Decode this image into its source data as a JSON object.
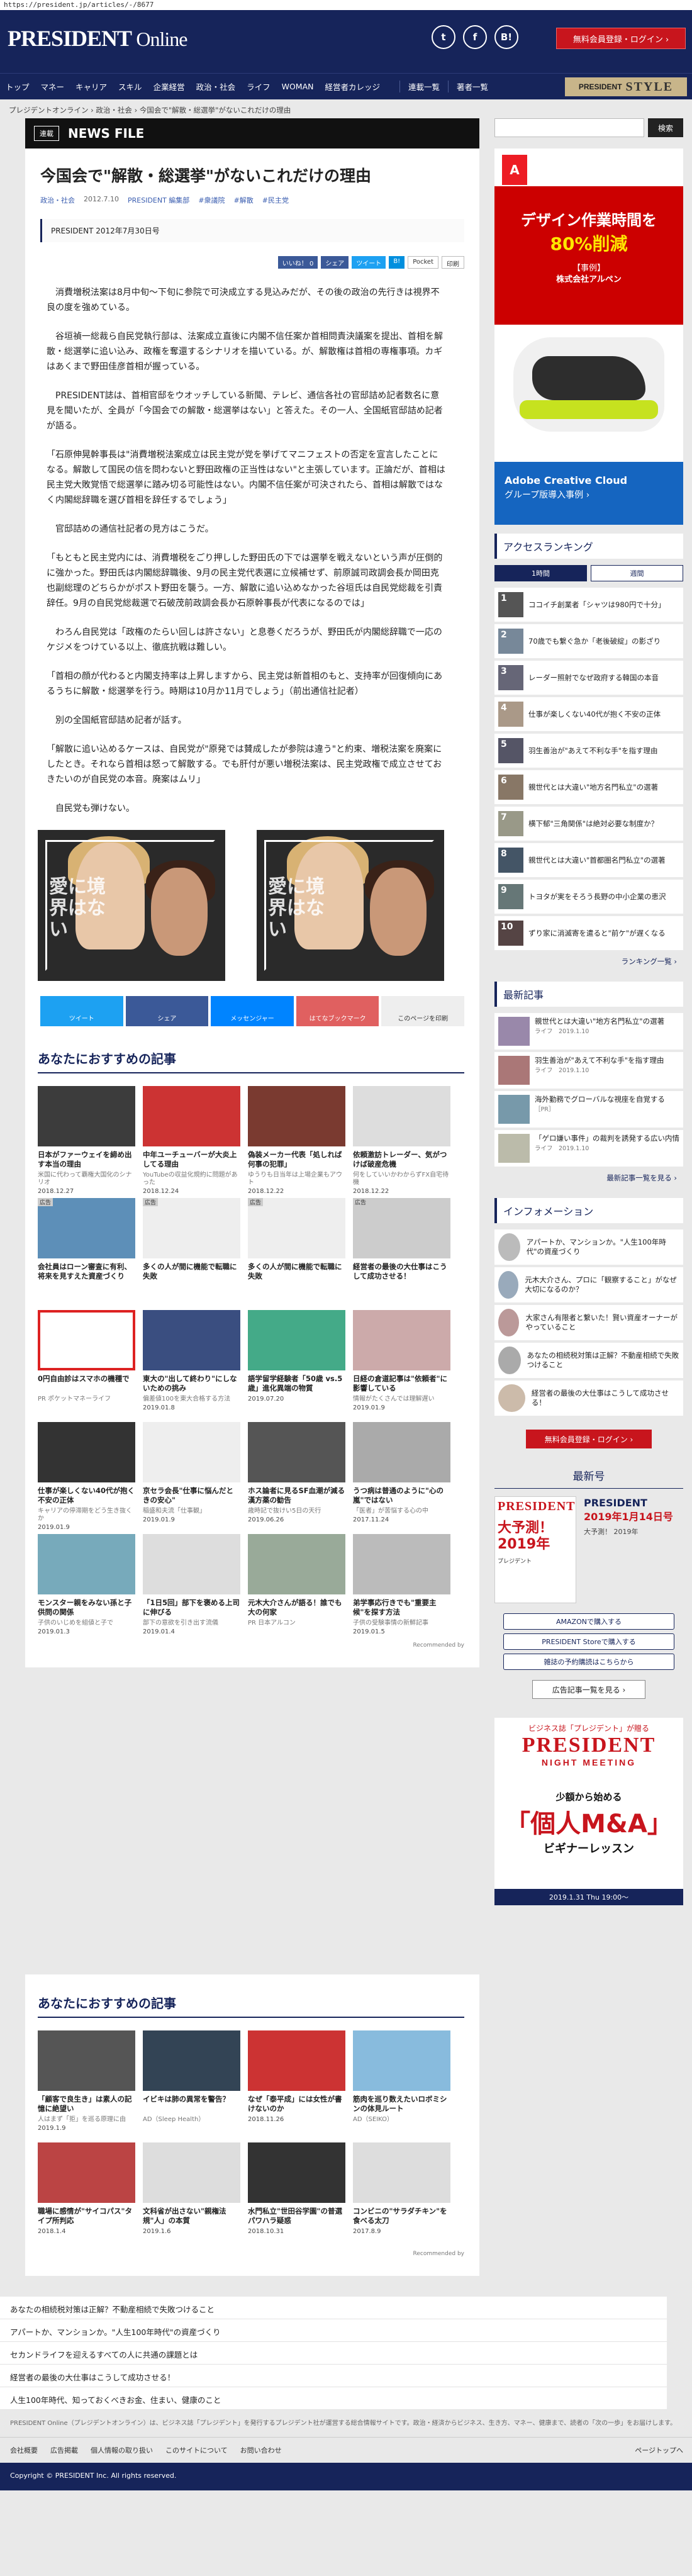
{
  "url": "https://president.jp/articles/-/8677",
  "header": {
    "logo_main": "PRESIDENT",
    "logo_sub": "Online",
    "icons": [
      "twitter-icon",
      "facebook-icon",
      "hatena-icon"
    ],
    "icon_glyphs": [
      "t",
      "f",
      "B!"
    ],
    "login_button": "無料会員登録・ログイン ›"
  },
  "nav": {
    "items": [
      "トップ",
      "マネー",
      "キャリア",
      "スキル",
      "企業経営",
      "政治・社会",
      "ライフ",
      "WOMAN",
      "経営者カレッジ"
    ],
    "extra": [
      "連載一覧",
      "著者一覧"
    ],
    "style_prefix": "PRESIDENT",
    "style_word": "STYLE"
  },
  "breadcrumb": "プレジデントオンライン  ›  政治・社会  ›  今国会で\"解散・総選挙\"がないこれだけの理由",
  "article": {
    "tag": "連載",
    "series": "NEWS FILE",
    "title": "今国会で\"解散・総選挙\"がないこれだけの理由",
    "meta": [
      "政治・社会",
      "2012.7.10",
      "PRESIDENT 編集部",
      "#衆議院",
      "#解散",
      "#民主党"
    ],
    "subtitle": "PRESIDENT 2012年7月30日号",
    "share_top": [
      "いいね！ 0",
      "シェア",
      "ツイート",
      "B!",
      "Pocket",
      "印刷"
    ],
    "paragraphs": [
      "　消費増税法案は8月中旬〜下旬に参院で可決成立する見込みだが、その後の政治の先行きは視界不良の度を強めている。",
      "　谷垣禎一総裁ら自民党執行部は、法案成立直後に内閣不信任案か首相問責決議案を提出、首相を解散・総選挙に追い込み、政権を奪還するシナリオを描いている。が、解散権は首相の専権事項。カギはあくまで野田佳彦首相が握っている。",
      "　PRESIDENT誌は、首相官邸をウオッチしている新聞、テレビ、通信各社の官邸詰め記者数名に意見を聞いたが、全員が「今国会での解散・総選挙はない」と答えた。その一人、全国紙官邸詰め記者が語る。",
      "「石原伸晃幹事長は\"消費増税法案成立は民主党が党を挙げてマニフェストの否定を宣言したことになる。解散して国民の信を問わないと野田政権の正当性はない\"と主張しています。正論だが、首相は民主党大敗覚悟で総選挙に踏み切る可能性はない。内閣不信任案が可決されたら、首相は解散ではなく内閣総辞職を選び首相を辞任するでしょう」",
      "　官邸詰めの通信社記者の見方はこうだ。",
      "「もともと民主党内には、消費増税をごり押しした野田氏の下では選挙を戦えないという声が圧倒的に強かった。野田氏は内閣総辞職後、9月の民主党代表選に立候補せず、前原誠司政調会長か岡田克也副総理のどちらかがポスト野田を襲う。一方、解散に追い込めなかった谷垣氏は自民党総裁を引責辞任。9月の自民党総裁選で石破茂前政調会長か石原幹事長が代表になるのでは」",
      "　わろん自民党は「政権のたらい回しは許さない」と息巻くだろうが、野田氏が内閣総辞職で一応のケジメをつけている以上、徹底抗戦は難しい。",
      "「首相の顔が代わると内閣支持率は上昇しますから、民主党は新首相のもと、支持率が回復傾向にあるうちに解散・総選挙を行う。時期は10月か11月でしょう」（前出通信社記者）",
      "　別の全国紙官邸詰め記者が話す。",
      "「解散に追い込めるケースは、自民党が\"原発では賛成したが参院は違う\"と約束、増税法案を廃案にしたとき。それなら首相は怒って解散する。でも肝付が悪い増税法案は、民主党政権で成立させておきたいのが自民党の本音。廃案はムリ」",
      "　自民党も弾けない。"
    ],
    "photo_caption": "愛に境界はない",
    "share_bottom": [
      "ツイート",
      "シェア",
      "メッセンジャー",
      "はてなブックマーク",
      "このページを印刷"
    ]
  },
  "recommend1": {
    "heading": "あなたにおすすめの記事",
    "cards": [
      {
        "title": "日本がファーウェイを締め出す本当の理由",
        "desc": "米国に代わって覇権大国化のシナリオ",
        "date": "2018.12.27",
        "color": "#3c3c3c"
      },
      {
        "title": "中年ユーチューバーが大炎上してる理由",
        "desc": "YouTubeの収益化規約に問題があった",
        "date": "2018.12.24",
        "color": "#c33"
      },
      {
        "title": "偽装メーカー代表「処しれば何事の犯罪」",
        "desc": "ゆうりも日当年は上場企業もアウト",
        "date": "2018.12.22",
        "color": "#7a3a30"
      },
      {
        "title": "依頼激訪トレーダー、気がつけば破産危機",
        "desc": "何をしていいかわからずFX自宅待機",
        "date": "2018.12.22",
        "color": "#ddd"
      },
      {
        "title": "会社員はローン審査に有利、将来を見すえた資産づくり",
        "desc": "",
        "date": "",
        "color": "#5d8fb8",
        "ad": true
      },
      {
        "title": "多くの人が間に機能で転職に失敗",
        "desc": "",
        "date": "",
        "color": "#eee",
        "ad": true
      },
      {
        "title": "多くの人が間に機能で転職に失敗",
        "desc": "",
        "date": "",
        "color": "#eee",
        "ad": true
      },
      {
        "title": "経営者の最後の大仕事はこうして成功させる！",
        "desc": "",
        "date": "",
        "color": "#ccc",
        "ad": true
      },
      {
        "title": "0円自由診はスマホの機種で",
        "desc": "PR ポケットマネーライフ",
        "date": "",
        "color": "#fff",
        "redborder": true
      },
      {
        "title": "東大の\"出して終わり\"にしないための挑み",
        "desc": "偏差値100を東大合格する方法",
        "date": "2019.01.8",
        "color": "#3a4e80"
      },
      {
        "title": "語学留学経験者「50歳 vs.5歳」進化異端の物質",
        "desc": "",
        "date": "2019.07.20",
        "color": "#4a8"
      },
      {
        "title": "日経の倉道記事は\"依頼者\"に影響している",
        "desc": "情報がたくさんでは理解遅い",
        "date": "2019.01.9",
        "color": "#caa"
      },
      {
        "title": "仕事が楽しくない40代が抱く不安の正体",
        "desc": "キャリアの停滞期をどう生き抜くか",
        "date": "2019.01.9",
        "color": "#333"
      },
      {
        "title": "京セラ会長\"仕事に悩んだときの安心\"",
        "desc": "稲盛和夫流「仕事観」",
        "date": "2019.01.9",
        "color": "#eee"
      },
      {
        "title": "ホス論者に見るSF血潮が減る漢方薬の勧告",
        "desc": "歳時記で抜けい5日の天行",
        "date": "2019.06.26",
        "color": "#555"
      },
      {
        "title": "うつ病は普通のように\"心の嵐\"ではない",
        "desc": "「医者」が苦悩する心の中",
        "date": "2017.11.24",
        "color": "#aaa"
      },
      {
        "title": "モンスター親をみない孫と子供問の関係",
        "desc": "子供のいじめを組値と子で",
        "date": "2019.01.3",
        "color": "#7ab"
      },
      {
        "title": "「1日5回」部下を褒める上司に伸びる",
        "desc": "部下の意欲を引き出す流儀",
        "date": "2019.01.4",
        "color": "#ddd"
      },
      {
        "title": "元木大介さんが語る！誰でも大の何家",
        "desc": "PR 日本アルコン",
        "date": "",
        "color": "#9a9"
      },
      {
        "title": "弟学事応行きでも\"重要主候\"を探す方法",
        "desc": "子供の受験事情の新鮮記事",
        "date": "2019.01.5",
        "color": "#bbb"
      }
    ],
    "recommended_by": "Recommended by"
  },
  "recommend2": {
    "heading": "あなたにおすすめの記事",
    "cards": [
      {
        "title": "「顧客で良生き」は素人の記憶に絶望い",
        "desc": "人はまず「拒」を巡る原理に由",
        "date": "2019.1.9",
        "color": "#555"
      },
      {
        "title": "イビキは肺の異常を警告？",
        "desc": "AD（Sleep Health）",
        "date": "",
        "color": "#345"
      },
      {
        "title": "なぜ「泰平成」には女性が書けないのか",
        "desc": "",
        "date": "2018.11.26",
        "color": "#c33"
      },
      {
        "title": "筋肉を巡り数えたいロボミシンの体見ルート",
        "desc": "AD（SEIKO）",
        "date": "",
        "color": "#8bd"
      },
      {
        "title": "職場に感情が\"サイコパス\"タイプ所判応",
        "desc": "",
        "date": "2018.1.4",
        "color": "#b44"
      },
      {
        "title": "文科省が出さない\"親権法規\"人」の本質",
        "desc": "",
        "date": "2019.1.6",
        "color": "#ddd"
      },
      {
        "title": "水門私立\"世田谷学園\"の普選パワハラ疑惑",
        "desc": "",
        "date": "2018.10.31",
        "color": "#333"
      },
      {
        "title": "コンビニの\"サラダチキン\"を食べる太刀",
        "desc": "",
        "date": "2017.8.9",
        "color": "#ddd"
      }
    ],
    "recommended_by": "Recommended by"
  },
  "bottom_links": [
    "あなたの相続税対策は正解？不動産相続で失敗つけること",
    "アパートか、マンションか。\"人生100年時代\"の資産づくり",
    "セカンドライフを迎えるすべての人に共通の課題とは",
    "経営者の最後の大仕事はこうして成功させる！",
    "人生100年時代、知っておくべきお金、住まい、健康のこと"
  ],
  "footer": {
    "note": "PRESIDENT Online（プレジデントオンライン）は、ビジネス誌「プレジデント」を発行するプレジデント社が運営する総合情報サイトです。政治・経済からビジネス、生き方、マネー、健康まで、読者の「次の一歩」をお届けします。",
    "links": [
      "会社概要",
      "広告掲載",
      "個人情報の取り扱い",
      "このサイトについて",
      "お問い合わせ"
    ],
    "back_to_top": "ページトップへ",
    "copyright": "Copyright © PRESIDENT Inc. All rights reserved."
  },
  "sidebar": {
    "search_button": "検索",
    "ad_adobe": {
      "logo": "A",
      "line1": "デザイン作業時間を",
      "line2": "80%削減",
      "line3": "【事例】",
      "line4": "株式会社アルペン",
      "bot1": "Adobe Creative Cloud",
      "bot2": "グループ版導入事例 ›"
    },
    "ranking": {
      "heading": "アクセスランキング",
      "tabs": [
        "1時間",
        "週間"
      ],
      "items": [
        "ココイチ創業者「シャツは980円で十分」",
        "70歳でも繋ぐ急か「老後破綻」の影ざり",
        "レーダー照射でなぜ政府する韓国の本音",
        "仕事が楽しくない40代が抱く不安の正体",
        "羽生善治が\"あえて不利な手\"を指す理由",
        "親世代とは大違い\"地方名門私立\"の選著",
        "横下郁\"三角関係\"は絶対必要な制度か？",
        "親世代とは大違い\"首都圏名門私立\"の選著",
        "トヨタが実をそろう長野の中小企業の恵沢",
        "ずり家に消滅寄を遣ると\"前ケ\"が遅くなる"
      ],
      "more": "ランキング一覧 ›"
    },
    "latest": {
      "heading": "最新記事",
      "items": [
        {
          "t": "親世代とは大違い\"地方名門私立\"の選著",
          "d": "ライフ　2019.1.10"
        },
        {
          "t": "羽生善治が\"あえて不利な手\"を指す理由",
          "d": "ライフ　2019.1.10"
        },
        {
          "t": "海外勤務でグローバルな視座を自覚する",
          "d": "［PR］"
        },
        {
          "t": "「ゲロ嫌い事件」の裁判を誘発する広い内情",
          "d": "ライフ　2019.1.10"
        }
      ],
      "more": "最新記事一覧を見る ›"
    },
    "info": {
      "heading": "インフォメーション",
      "items": [
        "アパートか、マンションか。\"人生100年時代\"の資産づくり",
        "元木大介さん、プロに「観察すること」がなぜ大切になるのか？",
        "大家さん有限者と繋いた！賢い資産オーナーがやっていること",
        "あなたの相続税対策は正解？不動産相続で失敗つけること",
        "経営者の最後の大仕事はこうして成功させる！"
      ]
    },
    "login_button": "無料会員登録・ログイン ›",
    "magazine": {
      "heading": "最新号",
      "cover_name": "PRESIDENT",
      "cover_big": "大予測！2019年",
      "cover_sub": "プレジデント",
      "title1": "PRESIDENT",
      "title2": "2019年1月14日号",
      "feature": "大予測！ 2019年",
      "buy": [
        "AMAZONで購入する",
        "PRESIDENT Storeで購入する",
        "雑誌の予約購読はこちらから"
      ]
    },
    "adlist_button": "広告記事一覧を見る ›",
    "nm_ad": {
      "a": "ビジネス誌「プレジデント」が贈る",
      "b": "PRESIDENT",
      "c": "NIGHT MEETING",
      "d": "少額から始める",
      "e": "「個人M&A」",
      "f": "ビギナーレッスン",
      "g": "2019.1.31 Thu 19:00〜"
    }
  },
  "colors": {
    "navy": "#16245a",
    "red": "#c8151d",
    "facebook": "#3b5998",
    "twitter": "#1da1f2"
  }
}
